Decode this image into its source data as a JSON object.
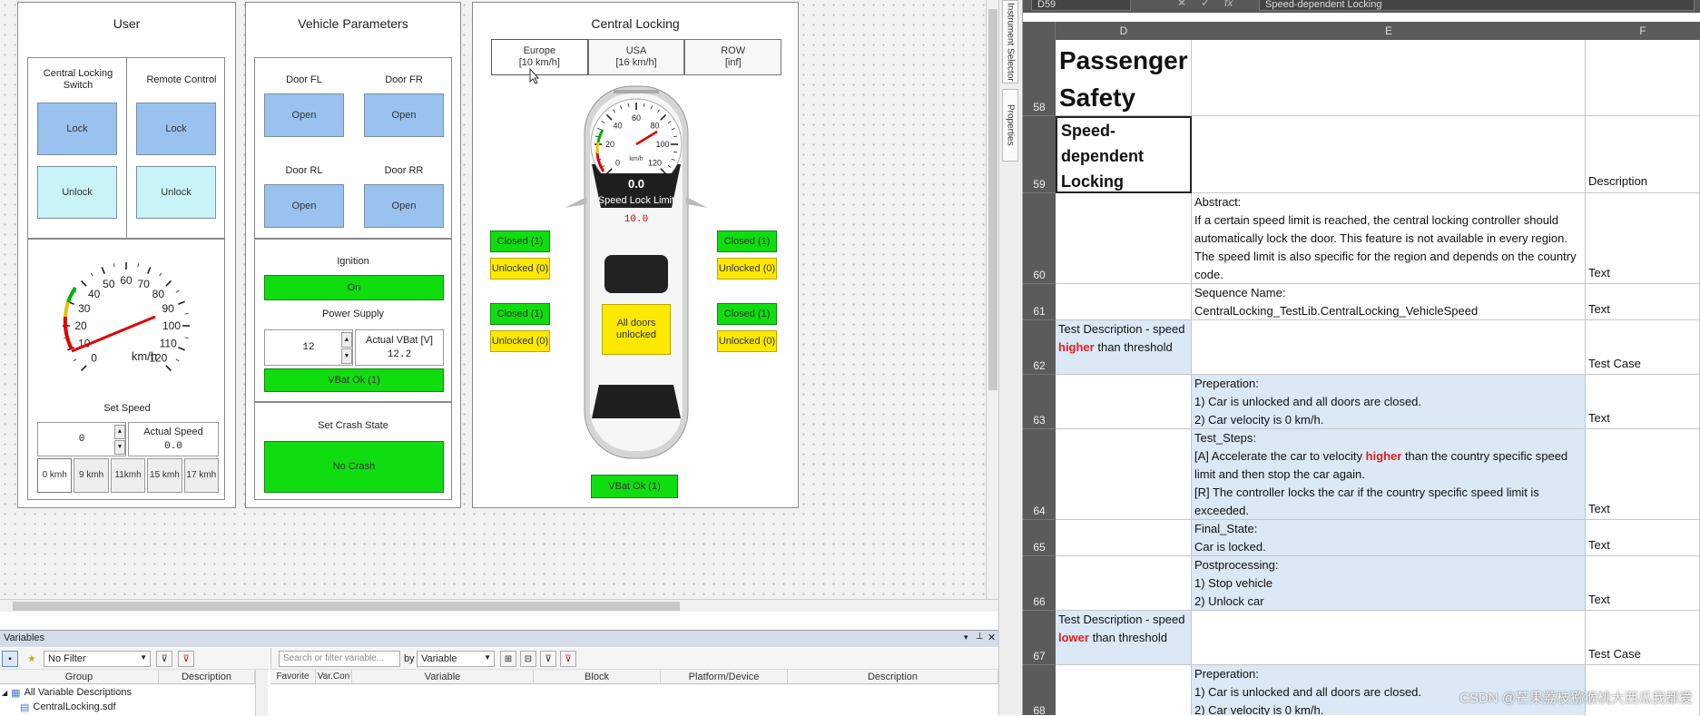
{
  "user_panel": {
    "title": "User",
    "switch_header": "Central Locking Switch",
    "remote_header": "Remote Control",
    "lock": "Lock",
    "unlock": "Unlock",
    "gauge_ticks": [
      "0",
      "10",
      "20",
      "30",
      "40",
      "50",
      "60",
      "70",
      "80",
      "90",
      "100",
      "110",
      "120"
    ],
    "gauge_unit": "km/h",
    "speed_value": 12,
    "set_speed_label": "Set Speed",
    "set_speed_value": "0",
    "actual_speed_label": "Actual Speed",
    "actual_speed_value": "0.0",
    "presets": [
      "0 kmh",
      "9 kmh",
      "11kmh",
      "15 kmh",
      "17 kmh"
    ]
  },
  "vehicle_panel": {
    "title": "Vehicle Parameters",
    "doors": [
      {
        "label": "Door FL",
        "button": "Open"
      },
      {
        "label": "Door FR",
        "button": "Open"
      },
      {
        "label": "Door RL",
        "button": "Open"
      },
      {
        "label": "Door RR",
        "button": "Open"
      }
    ],
    "ignition_label": "Ignition",
    "ignition_state": "On",
    "power_label": "Power Supply",
    "power_value": "12",
    "actual_vbat_label": "Actual VBat [V]",
    "actual_vbat_value": "12.2",
    "vbat_status": "VBat Ok (1)",
    "crash_label": "Set Crash State",
    "crash_state": "No Crash"
  },
  "locking_panel": {
    "title": "Central Locking",
    "regions": [
      {
        "name": "Europe",
        "limit": "[10 km/h]"
      },
      {
        "name": "USA",
        "limit": "[16 km/h]"
      },
      {
        "name": "ROW",
        "limit": "[inf]"
      }
    ],
    "gauge_ticks": [
      "0",
      "20",
      "40",
      "60",
      "80",
      "100",
      "120"
    ],
    "gauge_unit": "km/h",
    "speed_display": "0.0",
    "speed_lock_label": "Speed Lock Limit",
    "speed_lock_value": "10.0",
    "closed": "Closed (1)",
    "unlocked": "Unlocked (0)",
    "center_status": "All doors unlocked",
    "vbat_status": "VBat Ok (1)"
  },
  "variables_pane": {
    "title": "Variables",
    "filter": "No Filter",
    "search_placeholder": "Search or filter variable...",
    "by_label": "by",
    "by_value": "Variable",
    "left_columns": [
      "Group",
      "Description"
    ],
    "right_columns": [
      "Favorite",
      "Var.Con",
      "Variable",
      "Block",
      "Platform/Device",
      "Description"
    ],
    "tree": [
      "All Variable Descriptions",
      "CentralLocking.sdf"
    ]
  },
  "side_tabs": [
    "Instrument Selector",
    "Properties"
  ],
  "excel": {
    "name_box": "D59",
    "formula": "Speed-dependent Locking",
    "columns": [
      "D",
      "E",
      "F"
    ],
    "watermark": "CSDN @芒果荔枝猕猴桃大西瓜我都爱"
  }
}
